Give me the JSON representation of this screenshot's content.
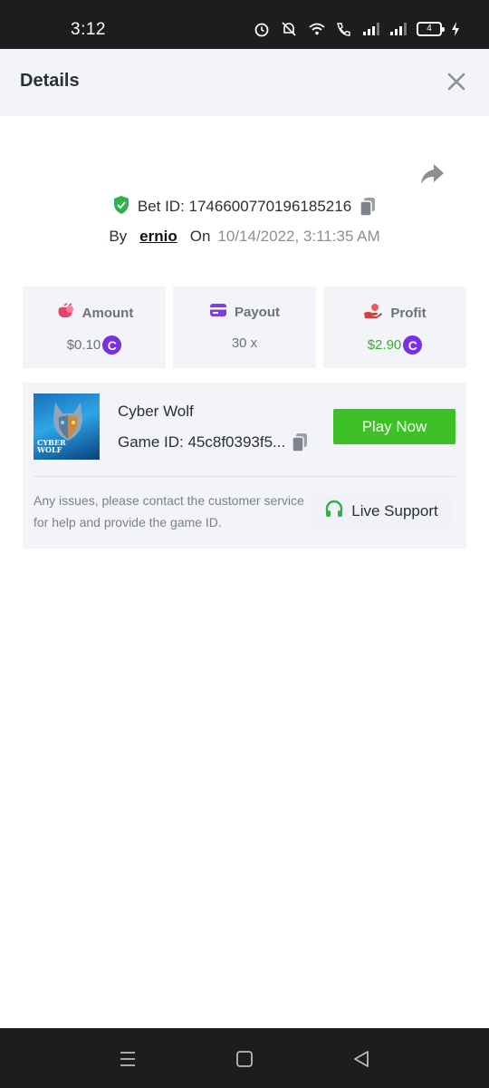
{
  "status_bar": {
    "time": "3:12",
    "battery": "4",
    "icons": [
      "alarm-icon",
      "mute-icon",
      "wifi-icon",
      "wifi-calling-icon",
      "signal-icon",
      "signal-icon",
      "battery-icon",
      "charging-icon"
    ]
  },
  "header": {
    "title": "Details",
    "close_icon": "close-icon"
  },
  "bet": {
    "id_text": "Bet ID: 1746600770196185216",
    "by_label": "By",
    "user": "ernio",
    "on_label": "On",
    "date": "10/14/2022, 3:11:35 AM"
  },
  "stats": [
    {
      "label": "Amount",
      "value": "$0.10",
      "icon": "money-bag-icon",
      "coin": "C"
    },
    {
      "label": "Payout",
      "value": "30 x",
      "icon": "card-icon"
    },
    {
      "label": "Profit",
      "value": "$2.90",
      "icon": "hand-coin-icon",
      "coin": "C"
    }
  ],
  "game": {
    "name": "Cyber Wolf",
    "id_text": "Game ID: 45c8f0393f5...",
    "thumb_text_line1": "CYBER",
    "thumb_text_line2": "WOLF",
    "play_label": "Play Now",
    "issue_text": "Any issues, please contact the customer service for help and provide the game ID.",
    "support_label": "Live Support"
  },
  "colors": {
    "accent_green": "#3ec126",
    "profit_green": "#3aa935",
    "coin_purple": "#7a2fe0",
    "card_bg": "#f3f4f8"
  }
}
